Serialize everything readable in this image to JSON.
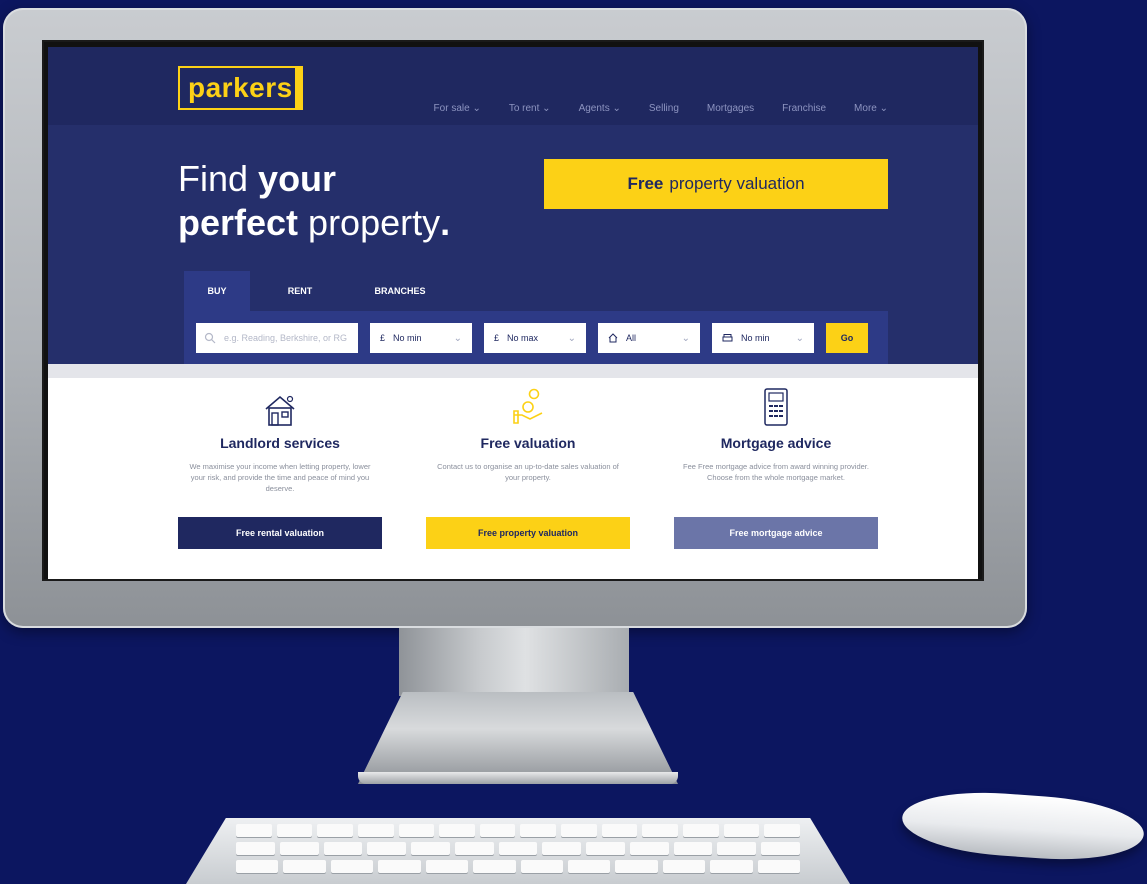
{
  "site": {
    "logo": "parkers",
    "nav": [
      "For sale ⌄",
      "To rent ⌄",
      "Agents ⌄",
      "Selling",
      "Mortgages",
      "Franchise",
      "More ⌄"
    ]
  },
  "hero": {
    "headline_line1_light": "Find ",
    "headline_line1_bold": "your",
    "headline_line2_bold": "perfect",
    "headline_line2_light": " property",
    "headline_dot": ".",
    "cta_bold": "Free",
    "cta_rest": "property valuation"
  },
  "search": {
    "tabs": [
      "BUY",
      "RENT",
      "BRANCHES"
    ],
    "placeholder": "e.g. Reading, Berkshire, or RG",
    "min_price": "No min",
    "max_price": "No max",
    "property_type": "All",
    "bedrooms": "No min",
    "go_label": "Go",
    "currency_symbol": "£"
  },
  "services": [
    {
      "icon": "house-icon",
      "title": "Landlord services",
      "text": "We maximise your income when letting property, lower your risk, and provide the time and peace of mind you deserve.",
      "button": "Free rental valuation"
    },
    {
      "icon": "coin-hand-icon",
      "title": "Free valuation",
      "text": "Contact us to organise an up-to-date sales valuation of your property.",
      "button": "Free property valuation"
    },
    {
      "icon": "calculator-icon",
      "title": "Mortgage advice",
      "text": "Fee Free mortgage advice from award winning provider. Choose from the whole mortgage market.",
      "button": "Free mortgage advice"
    }
  ],
  "colors": {
    "background": "#0c1660",
    "navy": "#1f2860",
    "accent_yellow": "#fcd116",
    "muted_blue": "#6b75a8"
  }
}
